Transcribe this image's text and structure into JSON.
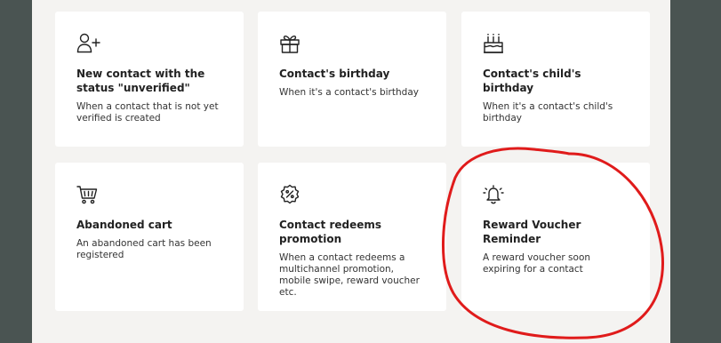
{
  "cards": [
    {
      "icon": "add-user-icon",
      "title": "New contact with the status \"unverified\"",
      "description": "When a contact that is not yet verified is created"
    },
    {
      "icon": "gift-icon",
      "title": "Contact's birthday",
      "description": "When it's a contact's birthday"
    },
    {
      "icon": "birthday-cake-icon",
      "title": "Contact's child's birthday",
      "description": "When it's a contact's child's birthday"
    },
    {
      "icon": "shopping-cart-icon",
      "title": "Abandoned cart",
      "description": "An abandoned cart has been registered"
    },
    {
      "icon": "discount-badge-icon",
      "title": "Contact redeems promotion",
      "description": "When a contact redeems a multichannel promotion, mobile swipe, reward voucher etc."
    },
    {
      "icon": "bell-icon",
      "title": "Reward Voucher Reminder",
      "description": "A reward voucher soon expiring for a contact"
    }
  ],
  "colors": {
    "backdrop": "#4a5452",
    "panel": "#f4f3f1",
    "card": "#ffffff",
    "annotation": "#e01b1b"
  }
}
